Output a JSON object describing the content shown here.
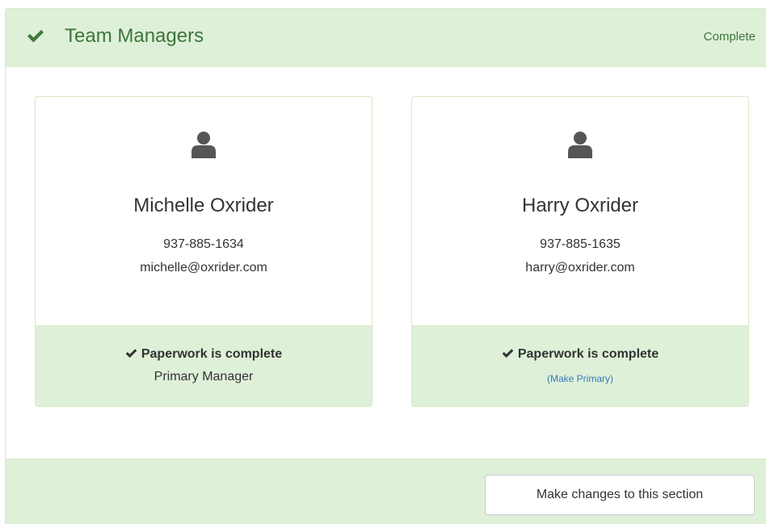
{
  "panel": {
    "title": "Team Managers",
    "status": "Complete",
    "title_icon": "check-icon"
  },
  "managers": [
    {
      "name": "Michelle Oxrider",
      "phone": "937-885-1634",
      "email": "michelle@oxrider.com",
      "paperwork_status": "Paperwork is complete",
      "role": "Primary Manager",
      "icon": "user-icon"
    },
    {
      "name": "Harry Oxrider",
      "phone": "937-885-1635",
      "email": "harry@oxrider.com",
      "paperwork_status": "Paperwork is complete",
      "action_link": "(Make Primary)",
      "icon": "user-icon"
    }
  ],
  "footer": {
    "button_label": "Make changes to this section"
  },
  "colors": {
    "success_bg": "#dff0d8",
    "success_border": "#d6e9c6",
    "success_text": "#3c763d",
    "link": "#337ab7",
    "text": "#333333",
    "icon": "#555555"
  }
}
